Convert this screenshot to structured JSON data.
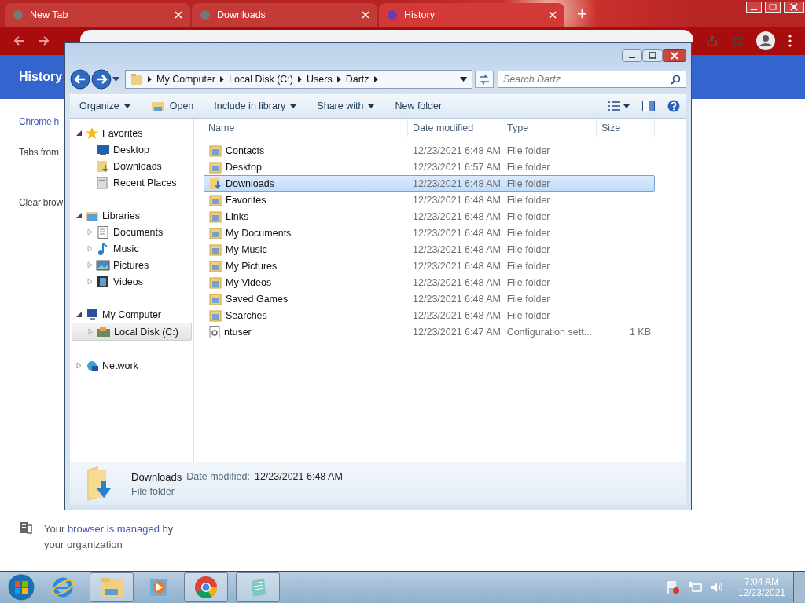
{
  "browser": {
    "tabs": [
      {
        "title": "New Tab",
        "selected": false
      },
      {
        "title": "Downloads",
        "selected": false
      },
      {
        "title": "History",
        "selected": true
      }
    ],
    "new_tab": "+",
    "page": {
      "title": "History",
      "sidebar": [
        "Chrome h",
        "Tabs from",
        "Clear brow"
      ],
      "managed": {
        "before": "Your ",
        "link": "browser is managed",
        "after": " by your organization"
      }
    }
  },
  "explorer": {
    "address": [
      "My Computer",
      "Local Disk (C:)",
      "Users",
      "Dartz"
    ],
    "search": {
      "placeholder": "Search Dartz"
    },
    "toolbar": [
      {
        "label": "Organize",
        "kind": "menu"
      },
      {
        "label": "Open",
        "kind": "open"
      },
      {
        "label": "Include in library",
        "kind": "menu"
      },
      {
        "label": "Share with",
        "kind": "menu"
      },
      {
        "label": "New folder",
        "kind": "plain"
      }
    ],
    "nav": [
      {
        "label": "Favorites",
        "kind": "star",
        "expanded": true,
        "children": [
          {
            "label": "Desktop",
            "kind": "desktop",
            "expandable": false,
            "selected": false
          },
          {
            "label": "Downloads",
            "kind": "download",
            "expandable": false,
            "selected": false
          },
          {
            "label": "Recent Places",
            "kind": "recent",
            "expandable": false,
            "selected": false
          }
        ]
      },
      {
        "label": "Libraries",
        "kind": "library",
        "expanded": true,
        "children": [
          {
            "label": "Documents",
            "kind": "doc",
            "expandable": true,
            "selected": false
          },
          {
            "label": "Music",
            "kind": "music",
            "expandable": true,
            "selected": false
          },
          {
            "label": "Pictures",
            "kind": "pictures",
            "expandable": true,
            "selected": false
          },
          {
            "label": "Videos",
            "kind": "video",
            "expandable": true,
            "selected": false
          }
        ]
      },
      {
        "label": "My Computer",
        "kind": "computer",
        "expanded": true,
        "children": [
          {
            "label": "Local Disk (C:)",
            "kind": "disk",
            "expandable": true,
            "selected": true
          }
        ]
      },
      {
        "label": "Network",
        "kind": "network",
        "expanded": false
      }
    ],
    "columns": [
      "Name",
      "Date modified",
      "Type",
      "Size"
    ],
    "rows": [
      {
        "name": "Contacts",
        "date": "12/23/2021 6:48 AM",
        "type": "File folder",
        "kind": "folder",
        "selected": false
      },
      {
        "name": "Desktop",
        "date": "12/23/2021 6:57 AM",
        "type": "File folder",
        "kind": "folder",
        "selected": false
      },
      {
        "name": "Downloads",
        "date": "12/23/2021 6:48 AM",
        "type": "File folder",
        "kind": "download",
        "selected": true
      },
      {
        "name": "Favorites",
        "date": "12/23/2021 6:48 AM",
        "type": "File folder",
        "kind": "folder",
        "selected": false
      },
      {
        "name": "Links",
        "date": "12/23/2021 6:48 AM",
        "type": "File folder",
        "kind": "folder",
        "selected": false
      },
      {
        "name": "My Documents",
        "date": "12/23/2021 6:48 AM",
        "type": "File folder",
        "kind": "folder",
        "selected": false
      },
      {
        "name": "My Music",
        "date": "12/23/2021 6:48 AM",
        "type": "File folder",
        "kind": "folder",
        "selected": false
      },
      {
        "name": "My Pictures",
        "date": "12/23/2021 6:48 AM",
        "type": "File folder",
        "kind": "folder",
        "selected": false
      },
      {
        "name": "My Videos",
        "date": "12/23/2021 6:48 AM",
        "type": "File folder",
        "kind": "folder",
        "selected": false
      },
      {
        "name": "Saved Games",
        "date": "12/23/2021 6:48 AM",
        "type": "File folder",
        "kind": "folder",
        "selected": false
      },
      {
        "name": "Searches",
        "date": "12/23/2021 6:48 AM",
        "type": "File folder",
        "kind": "folder",
        "selected": false
      },
      {
        "name": "ntuser",
        "date": "12/23/2021 6:47 AM",
        "type": "Configuration sett...",
        "size": "1 KB",
        "kind": "file",
        "selected": false
      }
    ],
    "details": {
      "name": "Downloads",
      "date_label": "Date modified:",
      "date": "12/23/2021 6:48 AM",
      "type": "File folder"
    }
  },
  "taskbar": {
    "time": "7:04 AM",
    "date": "12/23/2021"
  }
}
